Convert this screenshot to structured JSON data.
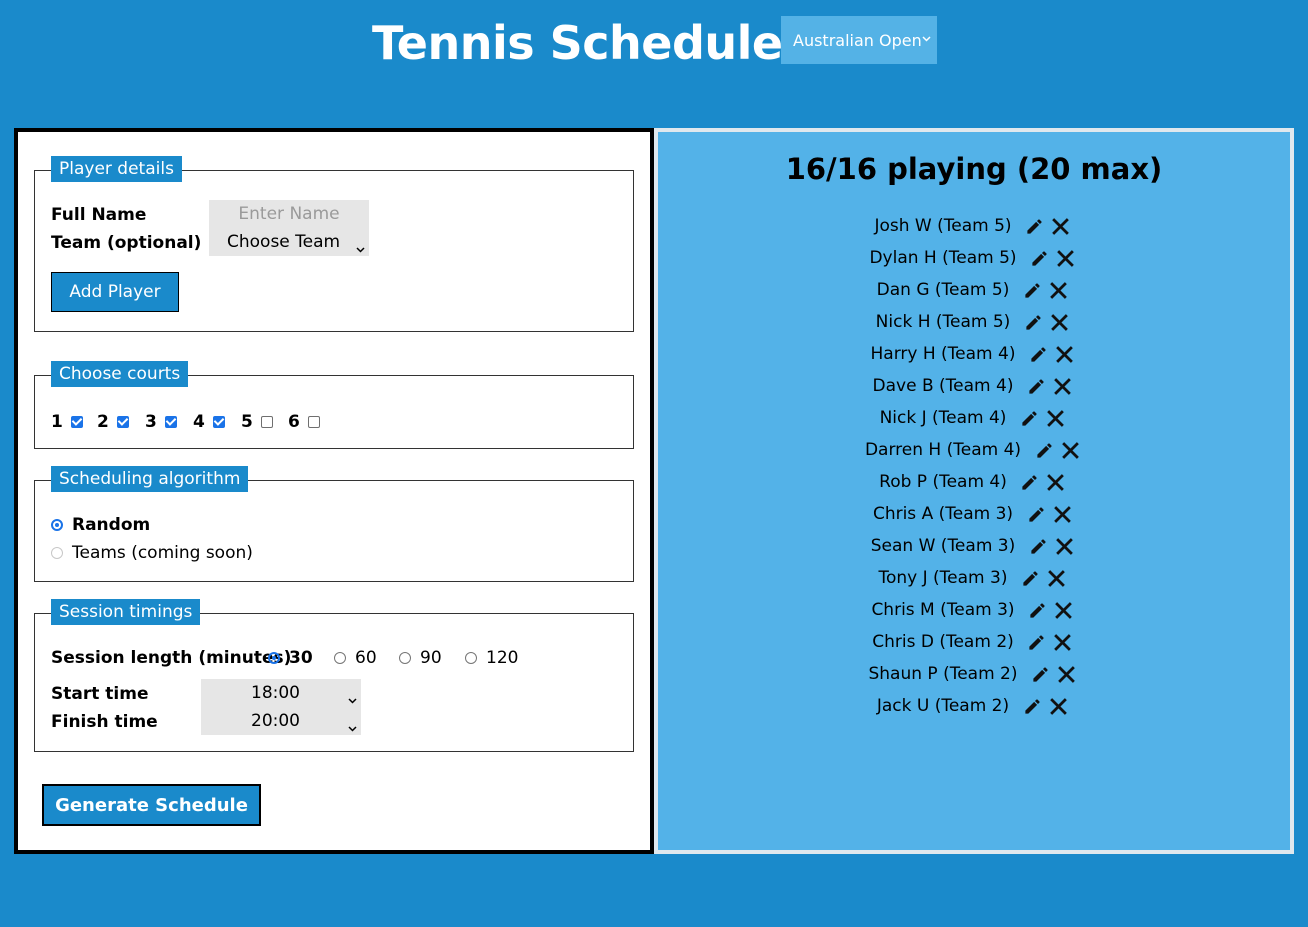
{
  "header": {
    "title": "Tennis Scheduler",
    "tournament_selected": "Australian Open"
  },
  "player_details": {
    "legend": "Player details",
    "full_name_label": "Full Name",
    "name_placeholder": "Enter Name",
    "team_label": "Team (optional)",
    "team_selected": "Choose Team",
    "add_button": "Add Player"
  },
  "courts": {
    "legend": "Choose courts",
    "items": [
      {
        "label": "1",
        "checked": true
      },
      {
        "label": "2",
        "checked": true
      },
      {
        "label": "3",
        "checked": true
      },
      {
        "label": "4",
        "checked": true
      },
      {
        "label": "5",
        "checked": false
      },
      {
        "label": "6",
        "checked": false
      }
    ]
  },
  "algorithm": {
    "legend": "Scheduling algorithm",
    "options": [
      {
        "label": "Random",
        "selected": true
      },
      {
        "label": "Teams (coming soon)",
        "selected": false,
        "disabled": true
      }
    ]
  },
  "timings": {
    "legend": "Session timings",
    "session_label": "Session length (minutes)",
    "session_options": [
      {
        "label": "30",
        "selected": true
      },
      {
        "label": "60",
        "selected": false
      },
      {
        "label": "90",
        "selected": false
      },
      {
        "label": "120",
        "selected": false
      }
    ],
    "start_label": "Start time",
    "start_value": "18:00",
    "finish_label": "Finish time",
    "finish_value": "20:00"
  },
  "generate_button": "Generate Schedule",
  "roster": {
    "title": "16/16 playing (20 max)",
    "players": [
      "Josh W (Team 5)",
      "Dylan H (Team 5)",
      "Dan G (Team 5)",
      "Nick H (Team 5)",
      "Harry H (Team 4)",
      "Dave B (Team 4)",
      "Nick J (Team 4)",
      "Darren H (Team 4)",
      "Rob P (Team 4)",
      "Chris A (Team 3)",
      "Sean W (Team 3)",
      "Tony J (Team 3)",
      "Chris M (Team 3)",
      "Chris D (Team 2)",
      "Shaun P (Team 2)",
      "Jack U (Team 2)"
    ]
  },
  "colors": {
    "background": "#1a8acb",
    "right_panel": "#53b2e8",
    "checkbox_accent": "#1a73e8"
  },
  "icons": {
    "edit": "pencil-icon",
    "remove": "close-icon",
    "dropdown": "chevron-down-icon"
  }
}
